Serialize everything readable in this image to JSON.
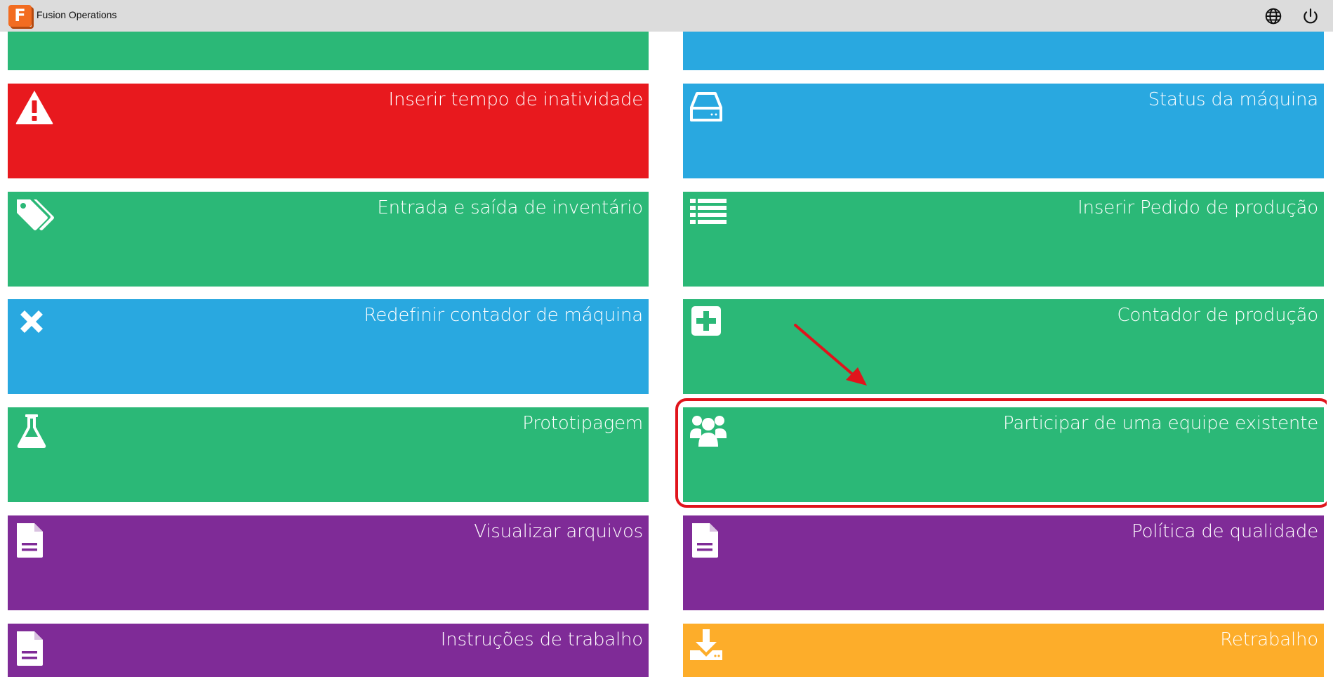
{
  "app": {
    "title": "Fusion Operations",
    "logo_letter": "F"
  },
  "header": {
    "icons": [
      "globe-icon",
      "power-icon"
    ]
  },
  "colors": {
    "green": "#2bb877",
    "blue": "#29a8e0",
    "red": "#e8191e",
    "purple": "#7f2b97",
    "orange": "#fdad2a",
    "highlight": "#e0141c"
  },
  "tiles": {
    "left": [
      {
        "label": "",
        "color": "green",
        "icon": "none"
      },
      {
        "label": "Inserir tempo de inatividade",
        "color": "red",
        "icon": "warning-icon"
      },
      {
        "label": "Entrada e saída de inventário",
        "color": "green",
        "icon": "tags-icon"
      },
      {
        "label": "Redefinir contador de máquina",
        "color": "blue",
        "icon": "close-icon"
      },
      {
        "label": "Prototipagem",
        "color": "green",
        "icon": "flask-icon"
      },
      {
        "label": "Visualizar arquivos",
        "color": "purple",
        "icon": "document-icon"
      },
      {
        "label": "Instruções de trabalho",
        "color": "purple",
        "icon": "document-icon"
      }
    ],
    "right": [
      {
        "label": "",
        "color": "blue",
        "icon": "none"
      },
      {
        "label": "Status da máquina",
        "color": "blue",
        "icon": "hard-drive-icon"
      },
      {
        "label": "Inserir Pedido de produção",
        "color": "green",
        "icon": "list-icon"
      },
      {
        "label": "Contador de produção",
        "color": "green",
        "icon": "plus-square-icon"
      },
      {
        "label": "Participar de uma equipe existente",
        "color": "green",
        "icon": "users-icon",
        "highlighted": true
      },
      {
        "label": "Política de qualidade",
        "color": "purple",
        "icon": "document-icon"
      },
      {
        "label": "Retrabalho",
        "color": "orange",
        "icon": "download-icon"
      }
    ]
  }
}
